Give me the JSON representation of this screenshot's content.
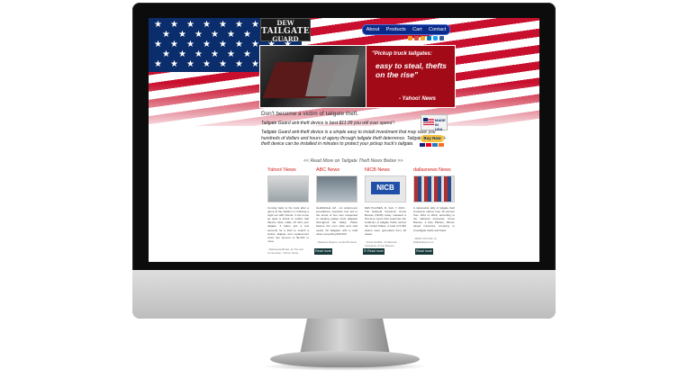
{
  "site": {
    "logo": {
      "line1": "DEW",
      "line2": "TAILGATE",
      "line3": "GUARD"
    },
    "nav": [
      {
        "label": "About"
      },
      {
        "label": "Products"
      },
      {
        "label": "Cart"
      },
      {
        "label": "Contact"
      }
    ],
    "social_icons": [
      {
        "icon": "rss-icon",
        "color": "#f7941d"
      },
      {
        "icon": "google-plus-icon",
        "color": "#dd4b39"
      },
      {
        "icon": "email-icon",
        "color": "#f5a623"
      },
      {
        "icon": "linkedin-icon",
        "color": "#0077b5"
      },
      {
        "icon": "twitter-icon",
        "color": "#1da1f2"
      },
      {
        "icon": "facebook-icon",
        "color": "#3b5998"
      }
    ],
    "hero": {
      "quote_open": "\"Pickup truck tailgates:",
      "quote_main": "easy to steal, thefts on the rise\"",
      "source": "- Yahoo! News",
      "accent": "#a30a18"
    },
    "headline": "Don't become a victim of tailgate theft.",
    "price_line": "Tailgate Guard anti-theft device is best $11.99 you will ever spend !",
    "description": "Tailgate Guard anti-theft device is a simple easy to install investment that may save you hundreds of dollars and hours of agony through tailgate theft deterrence. Tailgate Guard anti-theft device can be installed in minutes to protect your pickup truck's tailgate.",
    "made_in": {
      "text": "MADE IN USA"
    },
    "paypal_label": "Buy Now",
    "read_more_link": "<< Read More on Tailgate Theft News Below >>",
    "news": [
      {
        "source": "Yahoo! News",
        "body": "Coming back to his truck after a game at the stadium or finishing a night out with friends, it can come as quite a shock to realize that thieves have made off with your tailgate. It takes just a few seconds for a thief to snatch a pickup tailgate and replacement costs can amount to $1,000 or more.",
        "byline": "- Rasheeda Burke, at The Car Connection, Yahoo! News",
        "button": "Read more",
        "img_colors": [
          "#d9d9d9",
          "#9aa3a8"
        ]
      },
      {
        "source": "ABC News",
        "body": "GLENDALE, AZ - An undercover surveillance operation has led to the arrest of two men suspected of stealing pickup truck tailgates throughout the Valley. Police believe the men stole and sold nearly 30 tailgates with a total value exceeding $30,000.",
        "byline": "- Natasha Rogers, at abc15 News",
        "button": "Read more",
        "img_colors": [
          "#6f7c86",
          "#b7c1c8"
        ]
      },
      {
        "source": "NICB News",
        "body": "DES PLAINES, Ill., Feb. 7, 2013 - The National Insurance Crime Bureau (NICB) today released a first-time report that examines the incidents of tailgate thefts across the United States. A total of 5,362 claims were generated from 40 states.",
        "byline": "- Frank Scafidi, of National Insurance Crime Bureau",
        "button": "Read more",
        "img_colors": [
          "#1f4fa8",
          "#e8e8e8"
        ]
      },
      {
        "source": "dallasnews News",
        "body": "A nationwide tally of tailgate theft insurance claims rose 30 percent from 2011 to 2012, according to the National Insurance Crime Bureau, a Des Plaines, Illinois-based insurance company to investigate thefts and fraud.",
        "byline": "- MIKE TAYLOR, at DallasNews.com",
        "button": "Read more",
        "img_colors": [
          "#b03030",
          "#2a4a8a"
        ]
      }
    ]
  }
}
